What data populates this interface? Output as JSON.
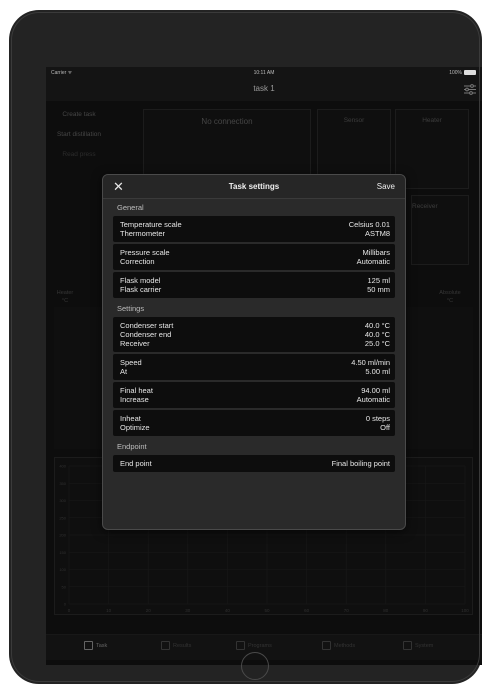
{
  "status_bar": {
    "carrier": "Carrier ᯤ",
    "time": "10:11 AM",
    "battery": "100%"
  },
  "nav": {
    "title": "task 1"
  },
  "left_menu": [
    "Create task",
    "Start distillation",
    "Read press"
  ],
  "panels": {
    "connection": "No connection",
    "sensor": "Sensor",
    "heater": "Heater",
    "receiver": "Receiver"
  },
  "table_headers": {
    "heater": "Heater\n°C",
    "absolute": "Absolute\n°C"
  },
  "chart_data": {
    "type": "line",
    "title": "",
    "xlabel": "",
    "ylabel": "",
    "x_ticks": [
      "0",
      "10",
      "20",
      "30",
      "40",
      "50",
      "60",
      "70",
      "80",
      "90",
      "100"
    ],
    "y_ticks": [
      "400",
      "350",
      "300",
      "250",
      "200",
      "150",
      "100",
      "50",
      "0"
    ],
    "xlim": [
      0,
      100
    ],
    "ylim": [
      0,
      400
    ],
    "grid": true,
    "series": []
  },
  "tabs": [
    {
      "label": "Task",
      "active": true
    },
    {
      "label": "Results",
      "active": false
    },
    {
      "label": "Programs",
      "active": false
    },
    {
      "label": "Methods",
      "active": false
    },
    {
      "label": "System",
      "active": false
    }
  ],
  "modal": {
    "close_icon": "✕",
    "title": "Task settings",
    "save_label": "Save",
    "sections": [
      {
        "title": "General",
        "groups": [
          [
            {
              "label": "Temperature scale",
              "value": "Celsius 0.01"
            },
            {
              "label": "Thermometer",
              "value": "ASTM8"
            }
          ],
          [
            {
              "label": "Pressure scale",
              "value": "Millibars"
            },
            {
              "label": "Correction",
              "value": "Automatic"
            }
          ],
          [
            {
              "label": "Flask model",
              "value": "125 ml"
            },
            {
              "label": "Flask carrier",
              "value": "50 mm"
            }
          ]
        ]
      },
      {
        "title": "Settings",
        "groups": [
          [
            {
              "label": "Condenser start",
              "value": "40.0 °C"
            },
            {
              "label": "Condenser end",
              "value": "40.0 °C"
            },
            {
              "label": "Receiver",
              "value": "25.0 °C"
            }
          ],
          [
            {
              "label": "Speed",
              "value": "4.50 ml/min"
            },
            {
              "label": "At",
              "value": "5.00 ml"
            }
          ],
          [
            {
              "label": "Final heat",
              "value": "94.00 ml"
            },
            {
              "label": "Increase",
              "value": "Automatic"
            }
          ],
          [
            {
              "label": "Inheat",
              "value": "0 steps"
            },
            {
              "label": "Optimize",
              "value": "Off"
            }
          ]
        ]
      },
      {
        "title": "Endpoint",
        "groups": [
          [
            {
              "label": "End point",
              "value": "Final boiling point"
            }
          ]
        ]
      }
    ]
  }
}
